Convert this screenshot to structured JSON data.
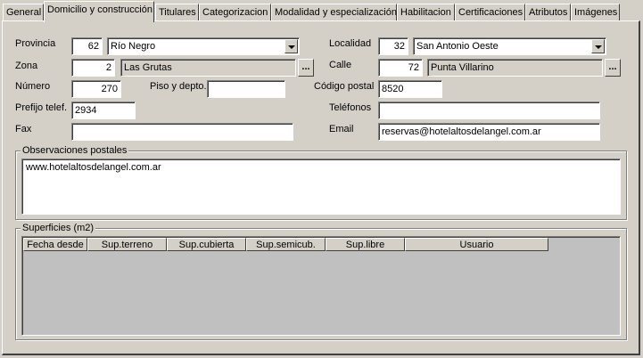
{
  "tabs": [
    {
      "label": "General"
    },
    {
      "label": "Domicilio y construcción"
    },
    {
      "label": "Titulares"
    },
    {
      "label": "Categorizacion"
    },
    {
      "label": "Modalidad y especialización"
    },
    {
      "label": "Habilitacion"
    },
    {
      "label": "Certificaciones"
    },
    {
      "label": "Atributos"
    },
    {
      "label": "Imágenes"
    }
  ],
  "form": {
    "provincia": {
      "label": "Provincia",
      "code": "62",
      "value": "Río Negro"
    },
    "zona": {
      "label": "Zona",
      "code": "2",
      "value": "Las Grutas",
      "browse": "..."
    },
    "numero": {
      "label": "Número",
      "value": "270"
    },
    "piso": {
      "label": "Piso y depto.",
      "value": ""
    },
    "prefijo": {
      "label": "Prefijo telef.",
      "value": "2934"
    },
    "fax": {
      "label": "Fax",
      "value": ""
    },
    "localidad": {
      "label": "Localidad",
      "code": "32",
      "value": "San Antonio Oeste"
    },
    "calle": {
      "label": "Calle",
      "code": "72",
      "value": "Punta Villarino",
      "browse": "..."
    },
    "codigo_postal": {
      "label": "Código postal",
      "value": "8520"
    },
    "telefonos": {
      "label": "Teléfonos",
      "value": ""
    },
    "email": {
      "label": "Email",
      "value": "reservas@hotelaltosdelangel.com.ar"
    }
  },
  "observaciones": {
    "title": "Observaciones postales",
    "text": "www.hotelaltosdelangel.com.ar"
  },
  "superficies": {
    "title": "Superficies (m2)",
    "columns": [
      "Fecha desde",
      "Sup.terreno",
      "Sup.cubierta",
      "Sup.semicub.",
      "Sup.libre",
      "Usuario"
    ]
  }
}
